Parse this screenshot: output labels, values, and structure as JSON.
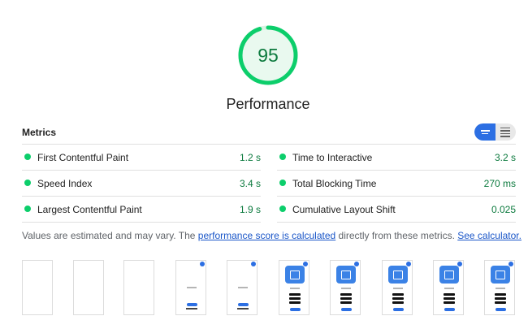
{
  "score": {
    "value": "95",
    "fraction": 0.95,
    "title": "Performance",
    "ring_color": "#0cce6b",
    "fill_color": "#e9f9ef",
    "text_color": "#0c7a3e"
  },
  "metrics": {
    "title": "Metrics",
    "toggle": {
      "left_icon": "list-view-icon",
      "right_icon": "text-view-icon",
      "active": "left"
    },
    "left": [
      {
        "label": "First Contentful Paint",
        "value": "1.2 s"
      },
      {
        "label": "Speed Index",
        "value": "3.4 s"
      },
      {
        "label": "Largest Contentful Paint",
        "value": "1.9 s"
      }
    ],
    "right": [
      {
        "label": "Time to Interactive",
        "value": "3.2 s"
      },
      {
        "label": "Total Blocking Time",
        "value": "270 ms"
      },
      {
        "label": "Cumulative Layout Shift",
        "value": "0.025"
      }
    ],
    "pass_color": "#0cce6b"
  },
  "note": {
    "prefix": "Values are estimated and may vary. The ",
    "link1": "performance score is calculated",
    "middle": " directly from these metrics. ",
    "link2": "See calculator."
  },
  "filmstrip": {
    "frames": [
      "blank",
      "blank",
      "blank",
      "text",
      "text",
      "app",
      "app",
      "app",
      "app",
      "app"
    ]
  }
}
